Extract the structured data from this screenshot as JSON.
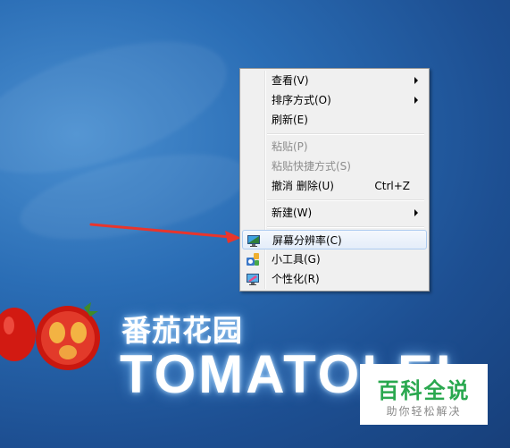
{
  "wallpaper": {
    "brand_cn": "番茄花园",
    "brand_en": "TOMATOLEI"
  },
  "context_menu": {
    "items": [
      {
        "label": "查看(V)",
        "submenu": true
      },
      {
        "label": "排序方式(O)",
        "submenu": true
      },
      {
        "label": "刷新(E)"
      },
      {
        "label": "粘贴(P)",
        "disabled": true
      },
      {
        "label": "粘贴快捷方式(S)",
        "disabled": true
      },
      {
        "label": "撤消 删除(U)",
        "shortcut": "Ctrl+Z"
      },
      {
        "label": "新建(W)",
        "submenu": true
      },
      {
        "label": "屏幕分辨率(C)",
        "icon": "monitor-icon",
        "highlighted": true
      },
      {
        "label": "小工具(G)",
        "icon": "gadgets-icon"
      },
      {
        "label": "个性化(R)",
        "icon": "personalize-icon"
      }
    ]
  },
  "watermark": {
    "title": "百科全说",
    "subtitle": "助你轻松解决"
  },
  "colors": {
    "annotation_arrow": "#e8352c",
    "watermark_green": "#2aa84f",
    "menu_highlight_border": "#aeccf0"
  }
}
